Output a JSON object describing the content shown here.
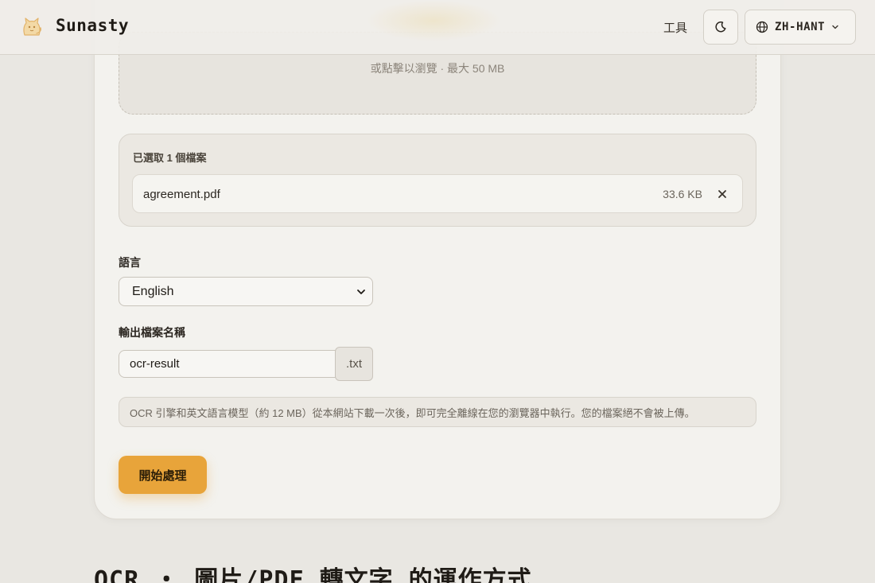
{
  "header": {
    "brand": "Sunasty",
    "nav_tools": "工具",
    "language": "ZH-HANT"
  },
  "dropzone": {
    "hint": "或點擊以瀏覽 · 最大 50 MB"
  },
  "selected": {
    "count_label": "已選取 1 個檔案",
    "file": {
      "name": "agreement.pdf",
      "size": "33.6 KB"
    }
  },
  "language_field": {
    "label": "語言",
    "selected": "English"
  },
  "output_field": {
    "label": "輸出檔案名稱",
    "value": "ocr-result",
    "extension": ".txt"
  },
  "info": {
    "text": "OCR 引擎和英文語言模型（約 12 MB）從本網站下載一次後，即可完全離線在您的瀏覽器中執行。您的檔案絕不會被上傳。"
  },
  "actions": {
    "start_label": "開始處理"
  },
  "section": {
    "title": "OCR ・ 圖片/PDF 轉文字 的運作方式"
  },
  "colors": {
    "accent": "#e8a43a",
    "background": "#e9e7e2",
    "card": "#f3f2ee"
  },
  "icons": {
    "logo": "cat-logo-icon",
    "theme": "moon-icon",
    "language": "globe-icon",
    "chevron": "chevron-down-icon",
    "remove": "close-icon"
  }
}
